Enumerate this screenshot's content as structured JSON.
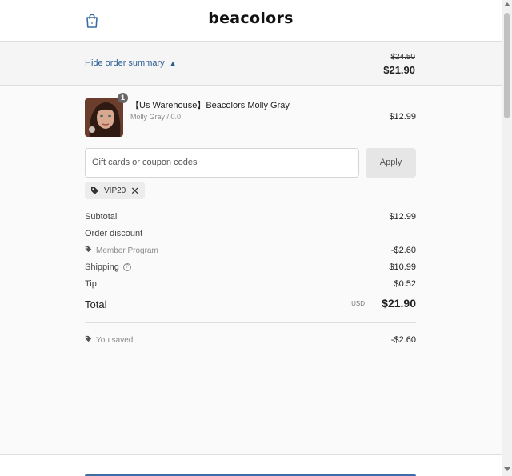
{
  "header": {
    "brand": "beacolors",
    "cart_icon": "shopping-bag-icon"
  },
  "summary_toggle": {
    "label": "Hide order summary",
    "original_total": "$24.50",
    "total": "$21.90"
  },
  "product": {
    "quantity": "1",
    "title": "【Us Warehouse】Beacolors Molly Gray",
    "variant": "Molly Gray / 0.0",
    "price": "$12.99"
  },
  "coupon": {
    "placeholder": "Gift cards or coupon codes",
    "apply_label": "Apply",
    "applied_code": "VIP20"
  },
  "lines": {
    "subtotal_label": "Subtotal",
    "subtotal_value": "$12.99",
    "order_discount_label": "Order discount",
    "member_program_label": "Member Program",
    "member_program_value": "-$2.60",
    "shipping_label": "Shipping",
    "shipping_value": "$10.99",
    "tip_label": "Tip",
    "tip_value": "$0.52",
    "total_label": "Total",
    "currency": "USD",
    "total_value": "$21.90",
    "saved_label": "You saved",
    "saved_value": "-$2.60"
  },
  "colors": {
    "accent": "#2a5b94",
    "summary_bg": "#f5f5f5",
    "main_bg": "#fafafa"
  }
}
